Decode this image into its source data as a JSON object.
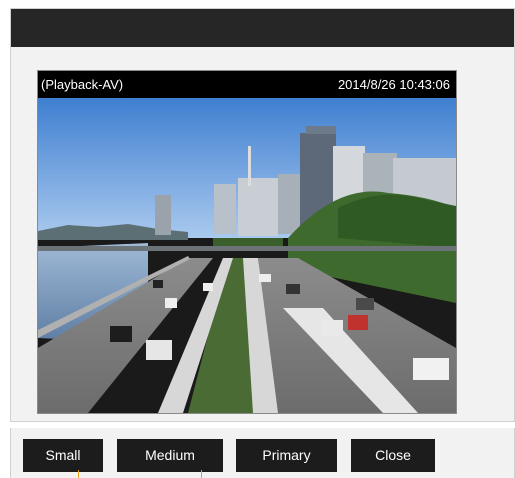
{
  "video": {
    "mode_label": "(Playback-AV)",
    "timestamp": "2014/8/26 10:43:06",
    "scene_icon": "highway-city-scene"
  },
  "buttons": {
    "small_label": "Small",
    "medium_label": "Medium",
    "primary_label": "Primary",
    "close_label": "Close"
  },
  "colors": {
    "titlebar": "#262626",
    "button_bg": "#1c1c1c",
    "button_text": "#ffffff",
    "panel_bg": "#f2f2f2",
    "osd_bg": "#000000"
  }
}
